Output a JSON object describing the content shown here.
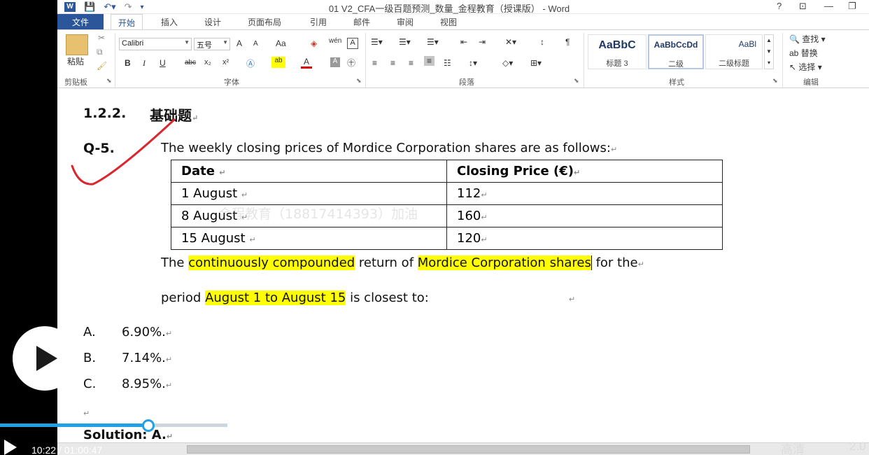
{
  "window": {
    "title": "01 V2_CFA一级百题预测_数量_金程教育（授课版） - Word",
    "help": "?",
    "controls": [
      "⊡",
      "—",
      "❐"
    ]
  },
  "tabs": {
    "file": "文件",
    "items": [
      "开始",
      "插入",
      "设计",
      "页面布局",
      "引用",
      "邮件",
      "审阅",
      "视图"
    ]
  },
  "ribbon": {
    "clipboard": {
      "paste": "粘贴",
      "label": "剪贴板"
    },
    "font": {
      "name": "Calibri",
      "size": "五号",
      "grow": "A",
      "shrink": "A",
      "case": "Aa",
      "phonetic": "wén",
      "bold": "B",
      "italic": "I",
      "underline": "U",
      "strike": "abc",
      "subscript": "x₂",
      "superscript": "x²",
      "label": "字体"
    },
    "paragraph": {
      "label": "段落"
    },
    "styles": {
      "label": "样式",
      "items": [
        {
          "preview": "AaBbC",
          "name": "标题 3"
        },
        {
          "preview": "AaBbCcDd",
          "name": "二级"
        },
        {
          "preview": "AaBl",
          "name": "二级标题"
        }
      ]
    },
    "editing": {
      "find": "查找",
      "replace": "替换",
      "select": "选择",
      "label": "编辑"
    }
  },
  "document": {
    "heading_num": "1.2.2.",
    "heading_text": "基础题",
    "question_num": "Q-5.",
    "question_text": "The weekly closing prices of Mordice Corporation shares are as follows:",
    "table": {
      "headers": [
        "Date",
        "Closing Price (€)"
      ],
      "rows": [
        [
          "1 August",
          "112"
        ],
        [
          "8 August",
          "160"
        ],
        [
          "15 August",
          "120"
        ]
      ]
    },
    "watermark": "金程教育（18817414393）加油",
    "line1": {
      "a": "The ",
      "b": "continuously compounded",
      "c": " return of ",
      "d": "Mordice Corporation shares",
      "e": " for the"
    },
    "line2": {
      "a": "period ",
      "b": "August 1 to August 15",
      "c": " is closest to:"
    },
    "options": [
      {
        "letter": "A.",
        "text": "6.90%."
      },
      {
        "letter": "B.",
        "text": "7.14%."
      },
      {
        "letter": "C.",
        "text": "8.95%."
      }
    ],
    "solution": "Solution: A."
  },
  "player": {
    "time": "10:22 / 01:00:47",
    "progress_percent": 17.5,
    "quality": "高清",
    "speed": "2.0"
  },
  "colors": {
    "word_blue": "#2b579a",
    "highlight": "#ffff00",
    "progress": "#22a0e6",
    "check_mark": "#d9262f"
  }
}
